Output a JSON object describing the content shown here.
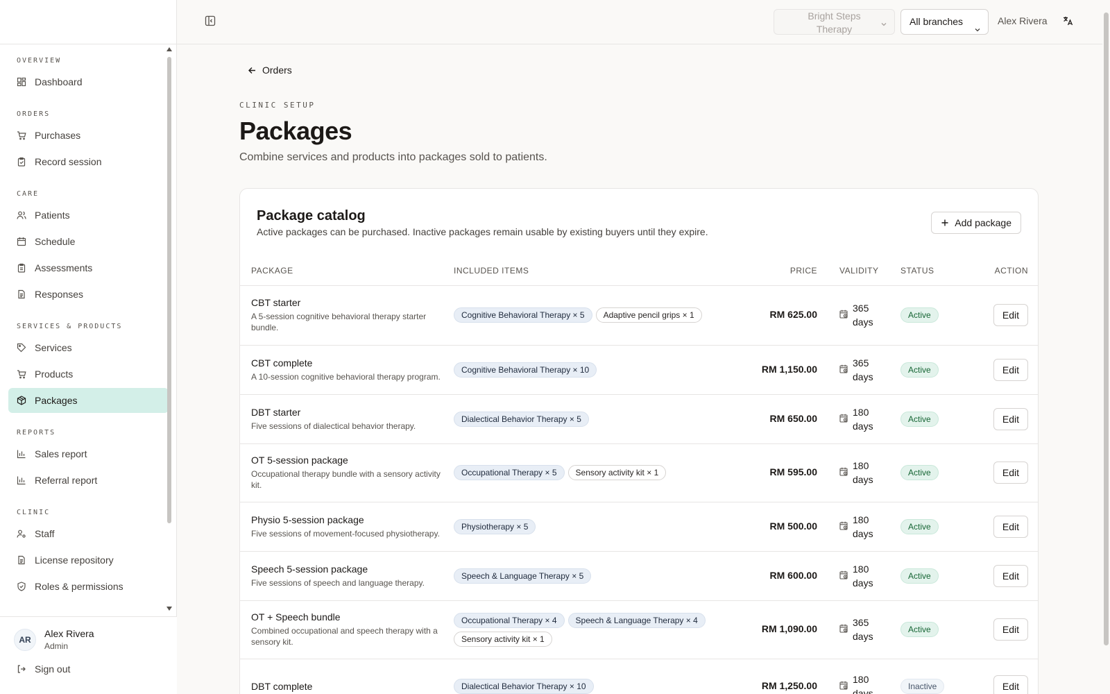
{
  "sidebar": {
    "sections": [
      {
        "label": "OVERVIEW",
        "items": [
          {
            "label": "Dashboard",
            "icon": "dashboard-icon"
          }
        ]
      },
      {
        "label": "ORDERS",
        "items": [
          {
            "label": "Purchases",
            "icon": "cart-icon"
          },
          {
            "label": "Record session",
            "icon": "clipboard-icon"
          }
        ]
      },
      {
        "label": "CARE",
        "items": [
          {
            "label": "Patients",
            "icon": "users-icon"
          },
          {
            "label": "Schedule",
            "icon": "calendar-icon"
          },
          {
            "label": "Assessments",
            "icon": "clipboard-list-icon"
          },
          {
            "label": "Responses",
            "icon": "file-text-icon"
          }
        ]
      },
      {
        "label": "SERVICES & PRODUCTS",
        "items": [
          {
            "label": "Services",
            "icon": "tag-icon"
          },
          {
            "label": "Products",
            "icon": "cart-icon"
          },
          {
            "label": "Packages",
            "icon": "package-icon",
            "active": true
          }
        ]
      },
      {
        "label": "REPORTS",
        "items": [
          {
            "label": "Sales report",
            "icon": "bar-chart-icon"
          },
          {
            "label": "Referral report",
            "icon": "bar-chart-icon"
          }
        ]
      },
      {
        "label": "CLINIC",
        "items": [
          {
            "label": "Staff",
            "icon": "user-cog-icon"
          },
          {
            "label": "License repository",
            "icon": "file-text-icon"
          },
          {
            "label": "Roles & permissions",
            "icon": "shield-check-icon"
          }
        ]
      }
    ],
    "user": {
      "initials": "AR",
      "name": "Alex Rivera",
      "role": "Admin"
    },
    "signout_label": "Sign out"
  },
  "topbar": {
    "clinic": "Bright Steps Therapy",
    "branch": "All branches",
    "user_name": "Alex Rivera"
  },
  "page": {
    "back_label": "Orders",
    "eyebrow": "CLINIC SETUP",
    "title": "Packages",
    "subtitle": "Combine services and products into packages sold to patients."
  },
  "catalog": {
    "title": "Package catalog",
    "description": "Active packages can be purchased. Inactive packages remain usable by existing buyers until they expire.",
    "add_label": "Add package",
    "columns": {
      "package": "PACKAGE",
      "items": "INCLUDED ITEMS",
      "price": "PRICE",
      "validity": "VALIDITY",
      "status": "STATUS",
      "action": "ACTION"
    },
    "edit_label": "Edit",
    "rows": [
      {
        "name": "CBT starter",
        "desc": "A 5-session cognitive behavioral therapy starter bundle.",
        "items": [
          {
            "label": "Cognitive Behavioral Therapy × 5",
            "kind": "service"
          },
          {
            "label": "Adaptive pencil grips × 1",
            "kind": "product"
          }
        ],
        "price": "RM 625.00",
        "validity_num": "365",
        "validity_unit": "days",
        "status": "Active"
      },
      {
        "name": "CBT complete",
        "desc": "A 10-session cognitive behavioral therapy program.",
        "items": [
          {
            "label": "Cognitive Behavioral Therapy × 10",
            "kind": "service"
          }
        ],
        "price": "RM 1,150.00",
        "validity_num": "365",
        "validity_unit": "days",
        "status": "Active"
      },
      {
        "name": "DBT starter",
        "desc": "Five sessions of dialectical behavior therapy.",
        "items": [
          {
            "label": "Dialectical Behavior Therapy × 5",
            "kind": "service"
          }
        ],
        "price": "RM 650.00",
        "validity_num": "180",
        "validity_unit": "days",
        "status": "Active"
      },
      {
        "name": "OT 5-session package",
        "desc": "Occupational therapy bundle with a sensory activity kit.",
        "items": [
          {
            "label": "Occupational Therapy × 5",
            "kind": "service"
          },
          {
            "label": "Sensory activity kit × 1",
            "kind": "product"
          }
        ],
        "price": "RM 595.00",
        "validity_num": "180",
        "validity_unit": "days",
        "status": "Active"
      },
      {
        "name": "Physio 5-session package",
        "desc": "Five sessions of movement-focused physiotherapy.",
        "items": [
          {
            "label": "Physiotherapy × 5",
            "kind": "service"
          }
        ],
        "price": "RM 500.00",
        "validity_num": "180",
        "validity_unit": "days",
        "status": "Active"
      },
      {
        "name": "Speech 5-session package",
        "desc": "Five sessions of speech and language therapy.",
        "items": [
          {
            "label": "Speech & Language Therapy × 5",
            "kind": "service"
          }
        ],
        "price": "RM 600.00",
        "validity_num": "180",
        "validity_unit": "days",
        "status": "Active"
      },
      {
        "name": "OT + Speech bundle",
        "desc": "Combined occupational and speech therapy with a sensory kit.",
        "items": [
          {
            "label": "Occupational Therapy × 4",
            "kind": "service"
          },
          {
            "label": "Speech & Language Therapy × 4",
            "kind": "service"
          },
          {
            "label": "Sensory activity kit × 1",
            "kind": "product"
          }
        ],
        "price": "RM 1,090.00",
        "validity_num": "365",
        "validity_unit": "days",
        "status": "Active"
      },
      {
        "name": "DBT complete",
        "desc": "",
        "items": [
          {
            "label": "Dialectical Behavior Therapy × 10",
            "kind": "service"
          }
        ],
        "price": "RM 1,250.00",
        "validity_num": "180",
        "validity_unit": "days",
        "status": "Inactive"
      }
    ]
  },
  "colors": {
    "accent_active_nav": "#d3efe8",
    "status_active": "#166534",
    "service_chip_bg": "#e8eef6"
  }
}
